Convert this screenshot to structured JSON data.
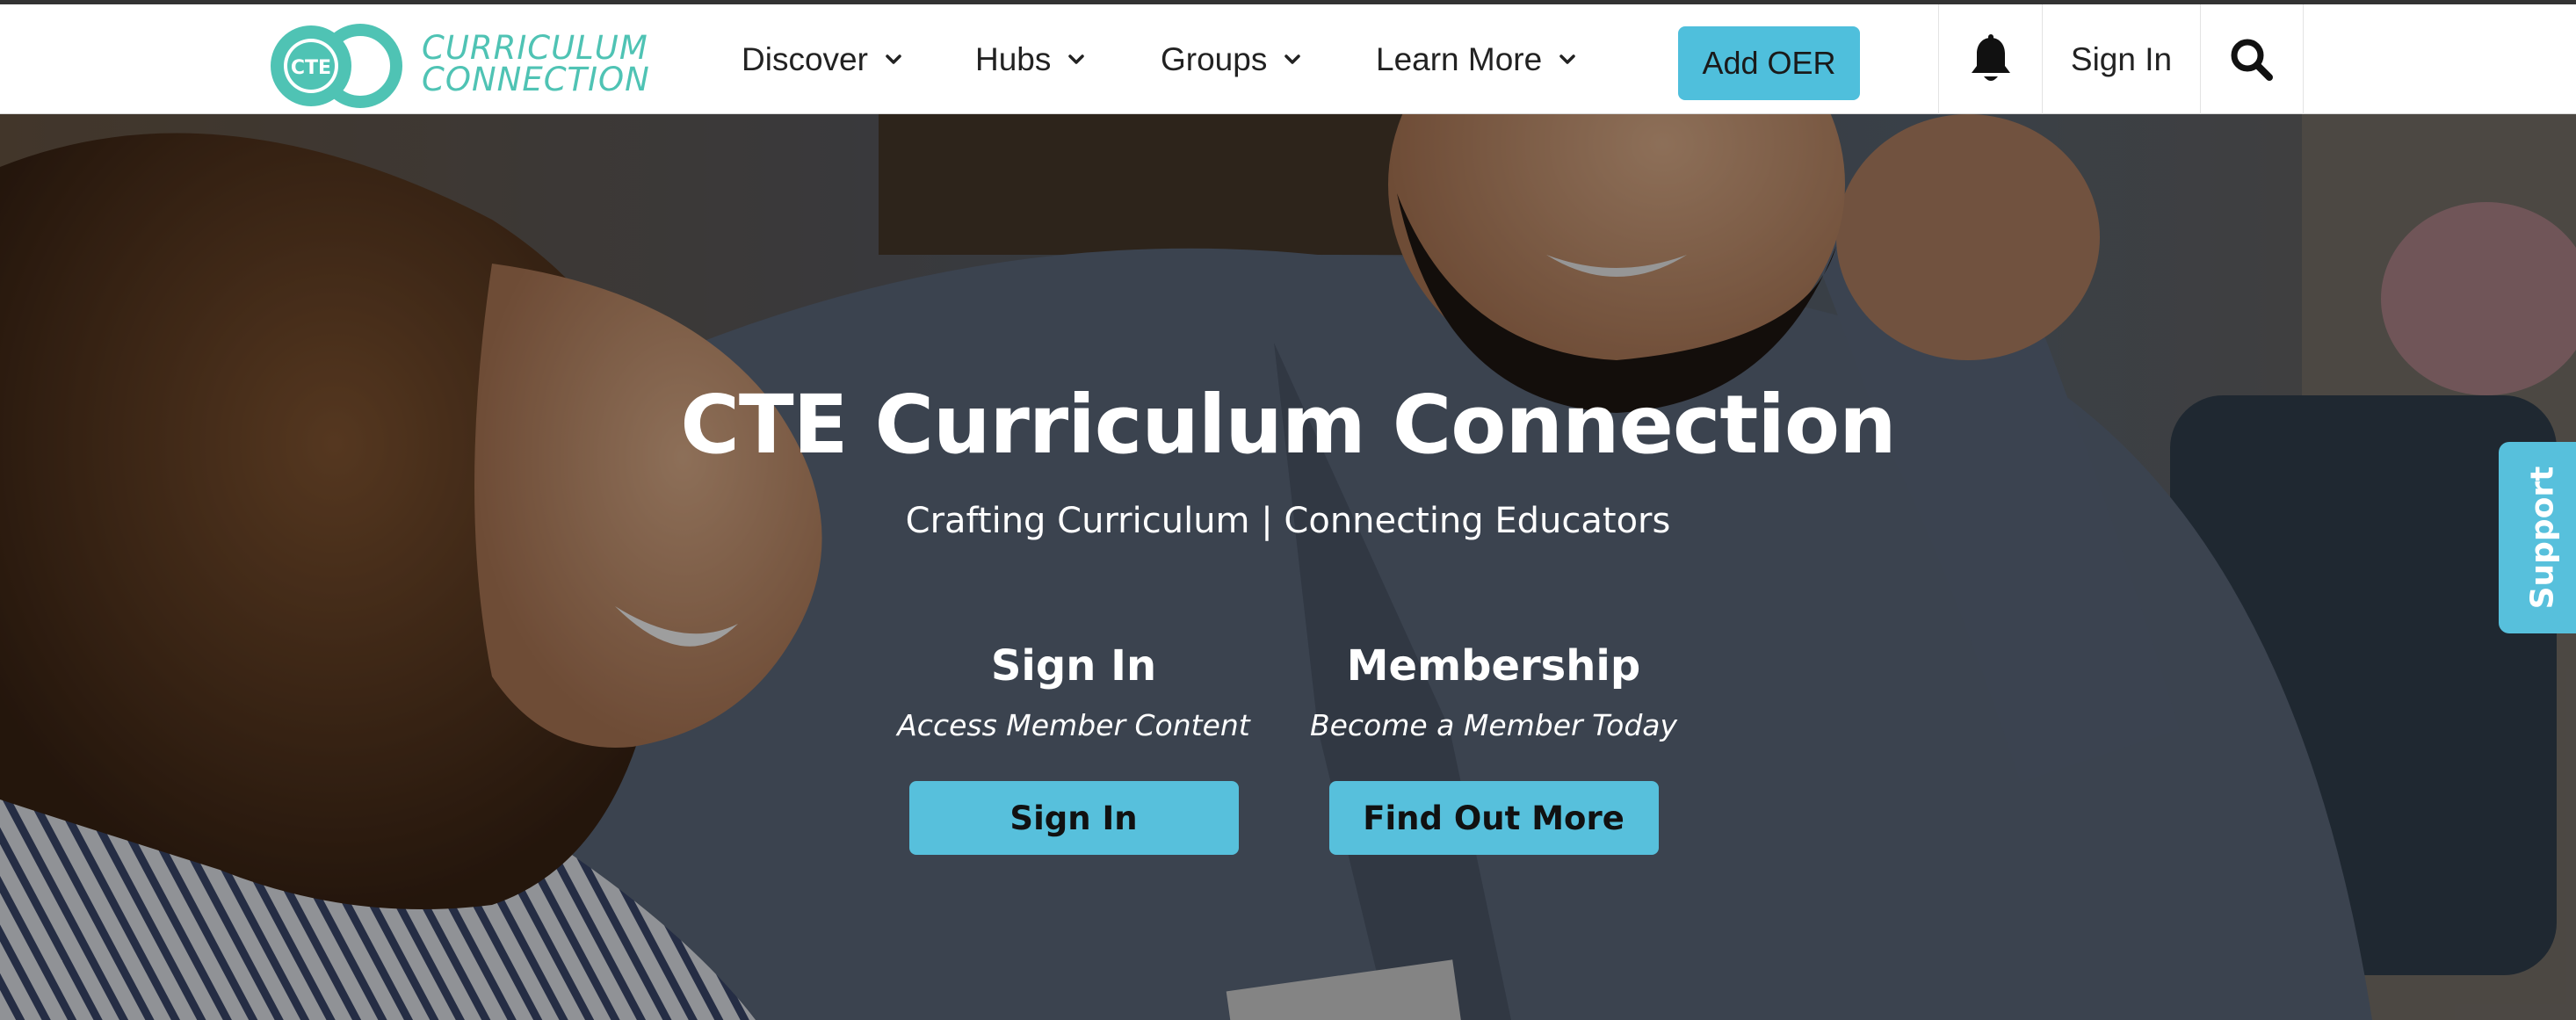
{
  "brand": {
    "logo_badge": "CTE",
    "logo_line1": "CURRICULUM",
    "logo_line2": "CONNECTION",
    "color": "#4fc3b4"
  },
  "nav": {
    "items": [
      {
        "label": "Discover"
      },
      {
        "label": "Hubs"
      },
      {
        "label": "Groups"
      },
      {
        "label": "Learn More"
      }
    ],
    "add_oer": "Add OER",
    "sign_in": "Sign In",
    "icons": [
      "bell-icon",
      "search-icon",
      "chevron-down-icon"
    ]
  },
  "hero": {
    "title": "CTE Curriculum Connection",
    "subtitle": "Crafting Curriculum | Connecting Educators",
    "signin": {
      "heading": "Sign In",
      "description": "Access Member Content",
      "button": "Sign In"
    },
    "membership": {
      "heading": "Membership",
      "description": "Become a Member Today",
      "button": "Find Out More"
    }
  },
  "support_tab": "Support",
  "colors": {
    "accent": "#57c0dc",
    "header_bg": "#ffffff",
    "text_dark": "#222222"
  }
}
